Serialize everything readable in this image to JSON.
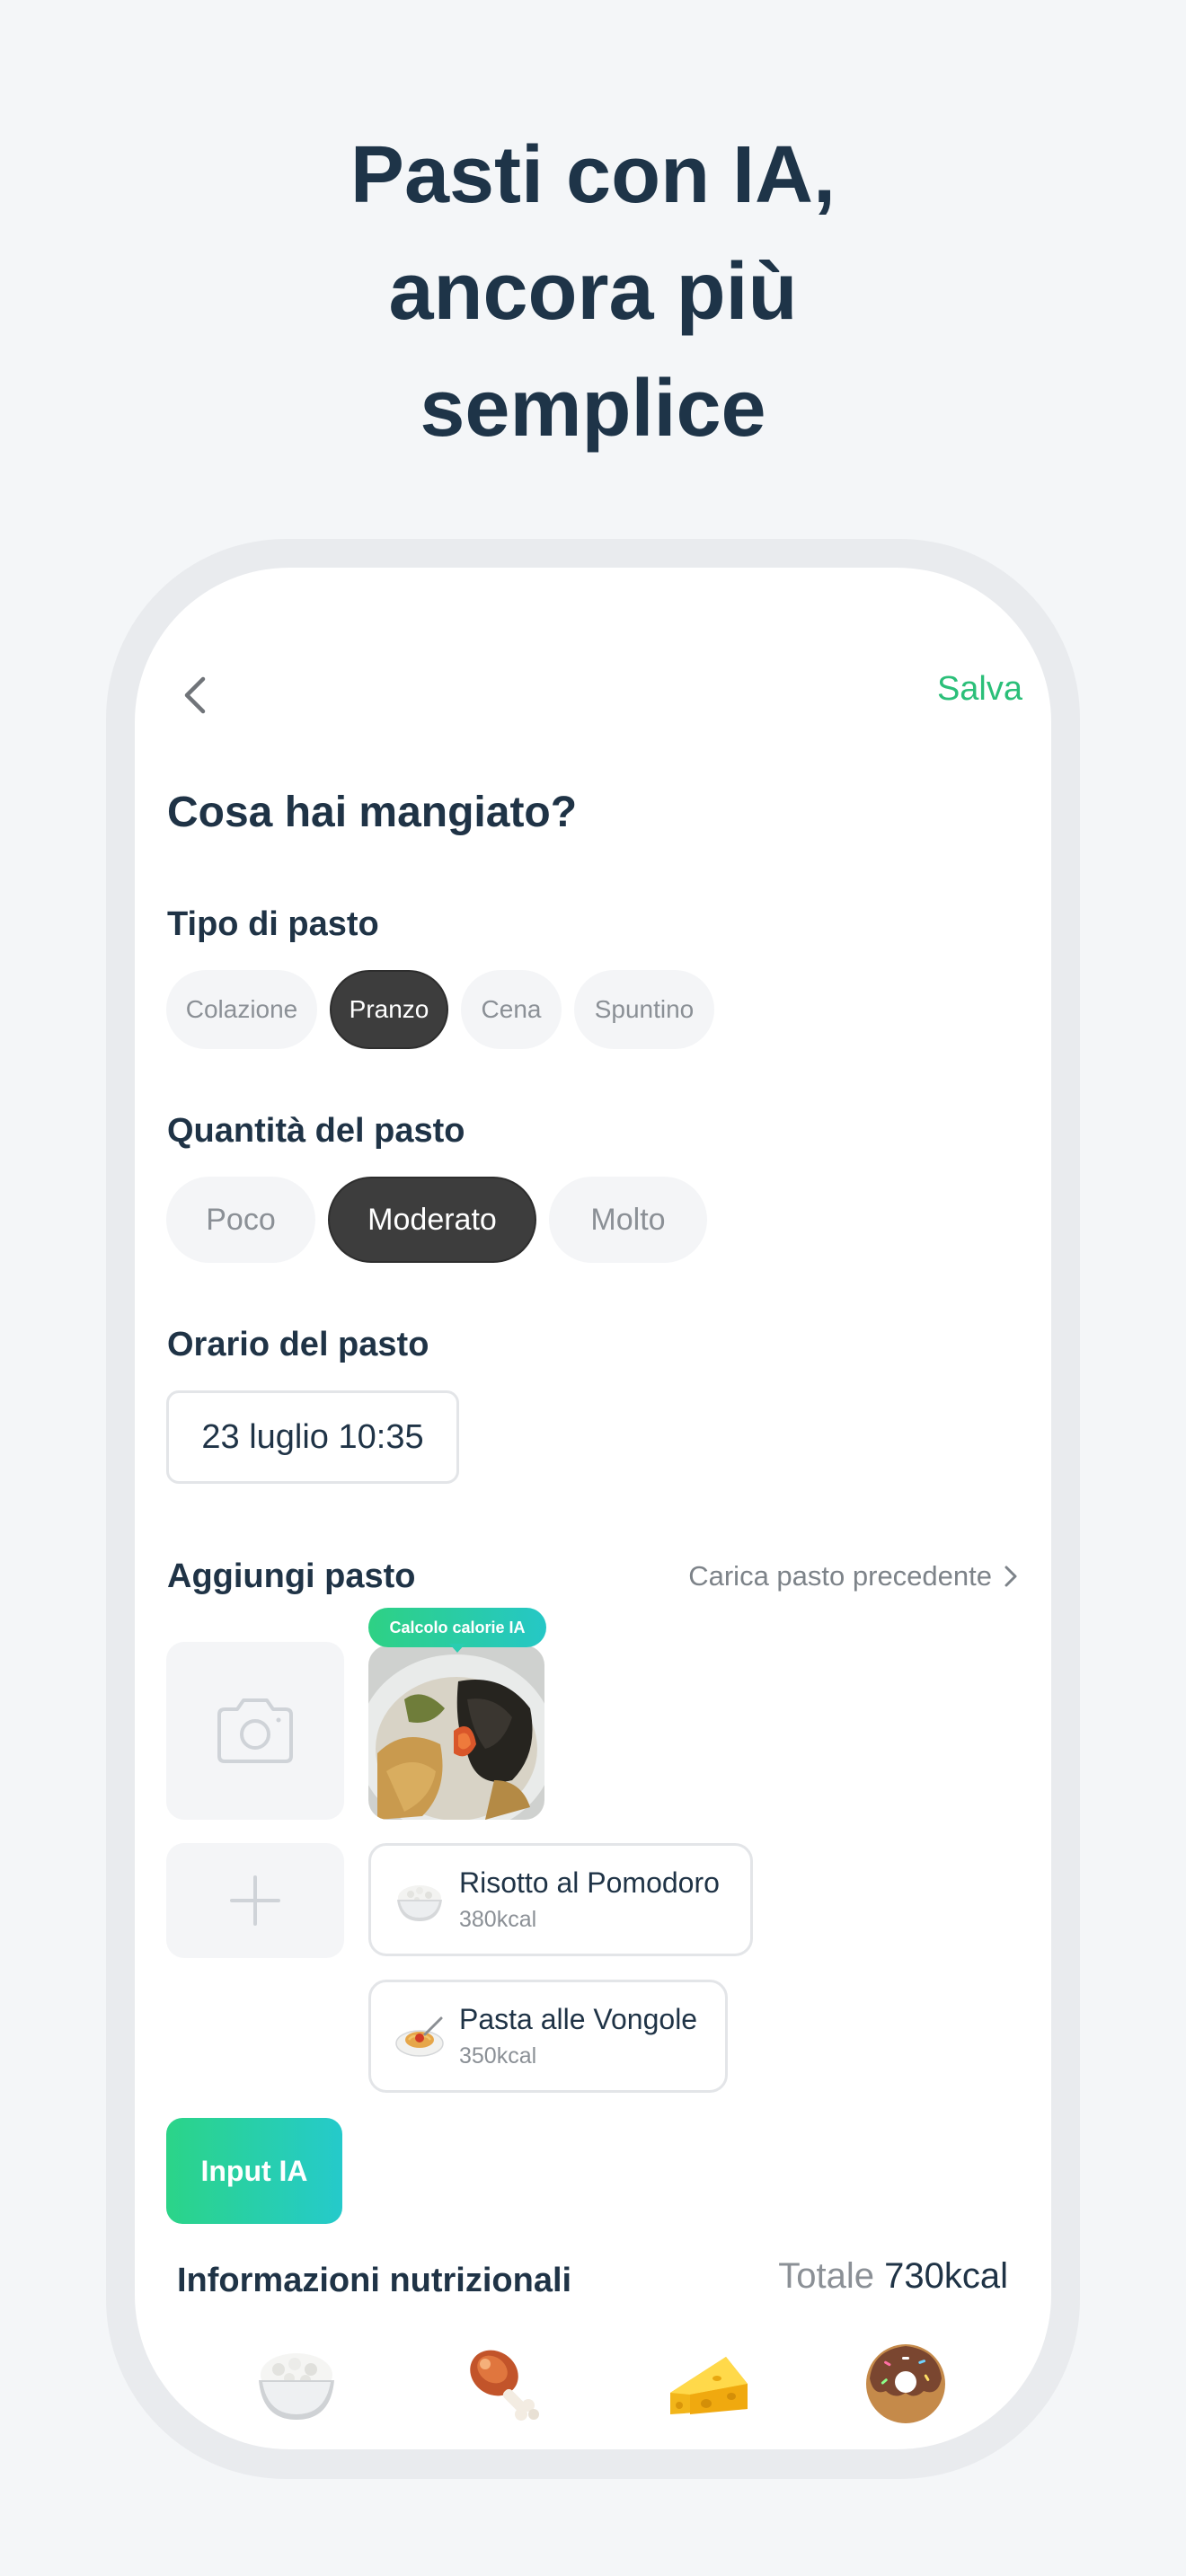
{
  "hero": {
    "line1": "Pasti con IA,",
    "line2": "ancora più",
    "line3": "semplice"
  },
  "header": {
    "save_label": "Salva"
  },
  "page_title": "Cosa hai mangiato?",
  "meal_type": {
    "label": "Tipo di pasto",
    "options": [
      "Colazione",
      "Pranzo",
      "Cena",
      "Spuntino"
    ],
    "selected": "Pranzo"
  },
  "meal_quantity": {
    "label": "Quantità del pasto",
    "options": [
      "Poco",
      "Moderato",
      "Molto"
    ],
    "selected": "Moderato"
  },
  "meal_time": {
    "label": "Orario del pasto",
    "value": "23 luglio 10:35"
  },
  "add_meal": {
    "label": "Aggiungi pasto",
    "load_previous": "Carica pasto precedente",
    "ai_badge": "Calcolo calorie IA",
    "items": [
      {
        "name": "Risotto al Pomodoro",
        "kcal": "380kcal",
        "icon": "rice-bowl-icon"
      },
      {
        "name": "Pasta alle Vongole",
        "kcal": "350kcal",
        "icon": "spaghetti-icon"
      }
    ],
    "ai_input_label": "Input IA"
  },
  "nutrition": {
    "label": "Informazioni nutrizionali",
    "total_label": "Totale",
    "total_value": "730kcal",
    "icons": [
      "rice-icon",
      "meat-icon",
      "cheese-icon",
      "donut-icon"
    ]
  },
  "colors": {
    "accent_green": "#2bbf79",
    "gradient_start": "#2bd488",
    "gradient_end": "#25cacb",
    "chip_active": "#3d3d3d",
    "text_dark": "#1f3346"
  }
}
